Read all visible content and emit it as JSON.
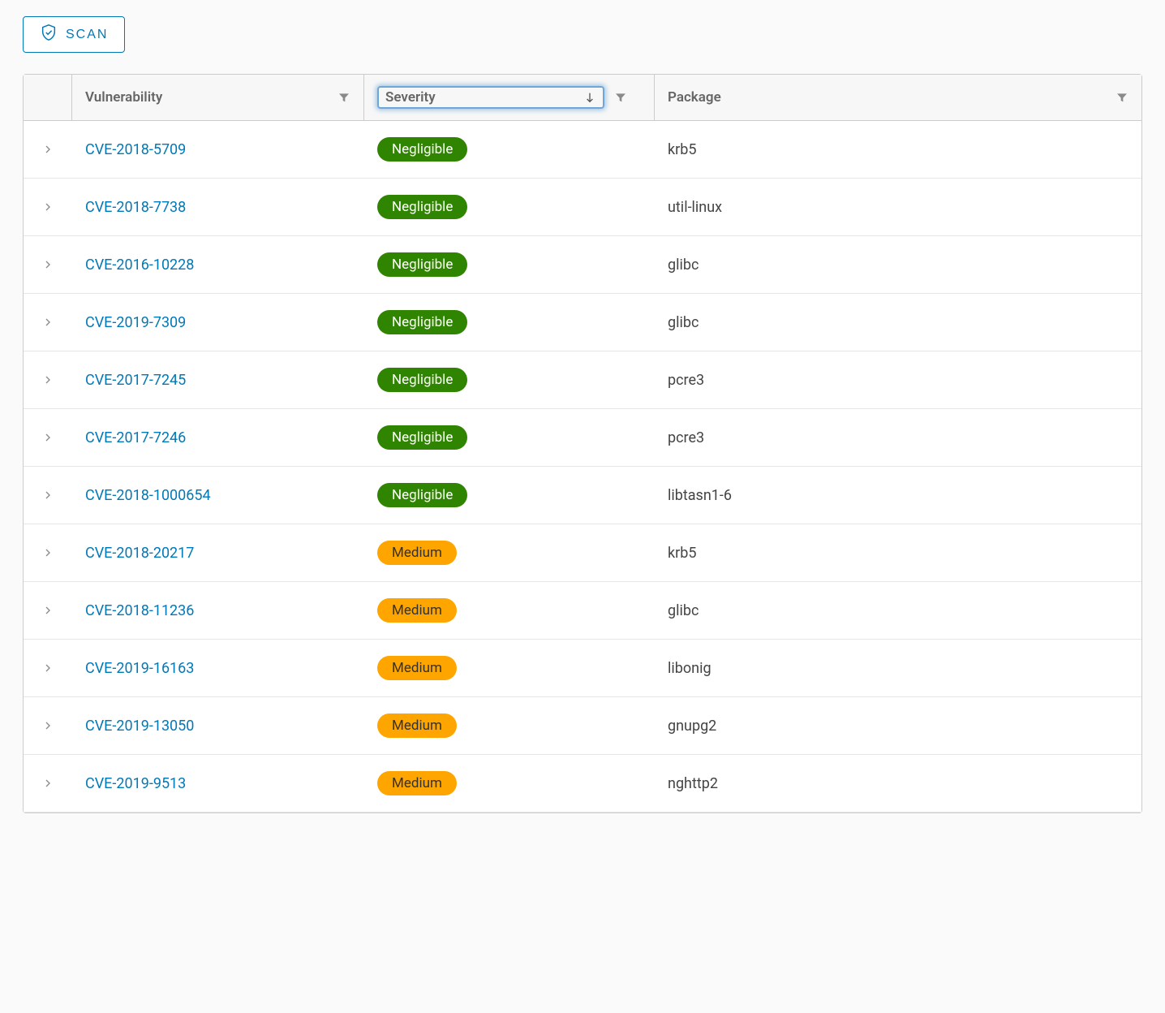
{
  "actions": {
    "scan_label": "SCAN"
  },
  "columns": {
    "vulnerability": "Vulnerability",
    "severity": "Severity",
    "package": "Package"
  },
  "severity_colors": {
    "Negligible": "#2f8400",
    "Medium": "#ffa500"
  },
  "rows": [
    {
      "cve": "CVE-2018-5709",
      "severity": "Negligible",
      "package": "krb5"
    },
    {
      "cve": "CVE-2018-7738",
      "severity": "Negligible",
      "package": "util-linux"
    },
    {
      "cve": "CVE-2016-10228",
      "severity": "Negligible",
      "package": "glibc"
    },
    {
      "cve": "CVE-2019-7309",
      "severity": "Negligible",
      "package": "glibc"
    },
    {
      "cve": "CVE-2017-7245",
      "severity": "Negligible",
      "package": "pcre3"
    },
    {
      "cve": "CVE-2017-7246",
      "severity": "Negligible",
      "package": "pcre3"
    },
    {
      "cve": "CVE-2018-1000654",
      "severity": "Negligible",
      "package": "libtasn1-6"
    },
    {
      "cve": "CVE-2018-20217",
      "severity": "Medium",
      "package": "krb5"
    },
    {
      "cve": "CVE-2018-11236",
      "severity": "Medium",
      "package": "glibc"
    },
    {
      "cve": "CVE-2019-16163",
      "severity": "Medium",
      "package": "libonig"
    },
    {
      "cve": "CVE-2019-13050",
      "severity": "Medium",
      "package": "gnupg2"
    },
    {
      "cve": "CVE-2019-9513",
      "severity": "Medium",
      "package": "nghttp2"
    }
  ]
}
